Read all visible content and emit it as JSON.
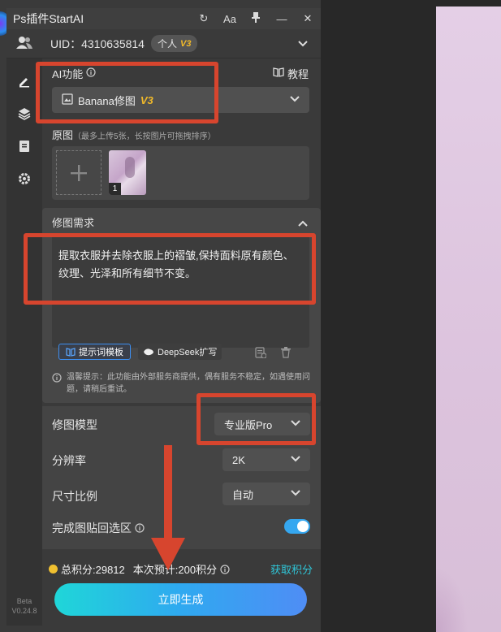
{
  "app": {
    "title": "Ps插件StartAI"
  },
  "titlebar": {
    "refresh": "↻",
    "font": "Aa",
    "pin": "⚲",
    "minimize": "—",
    "close": "✕"
  },
  "user": {
    "uid": "UID：4310635814",
    "plan": "个人",
    "version": "V3"
  },
  "sidebar": {
    "beta": "Beta",
    "version": "V0.24.8"
  },
  "ai_function": {
    "label": "AI功能",
    "tutorial": "教程",
    "selected": "Banana修图",
    "version": "V3"
  },
  "original": {
    "label": "原图",
    "hint": "（最多上传5张，长按图片可拖拽排序）",
    "thumb_index": "1"
  },
  "edit_request": {
    "label": "修图需求",
    "text": "提取衣服并去除衣服上的褶皱,保持面料原有颜色、纹理、光泽和所有细节不变。",
    "template_button": "提示词模板",
    "deepseek_button": "DeepSeek扩写",
    "notice": "温馨提示：此功能由外部服务商提供，偶有服务不稳定，如遇使用问题，请稍后重试。"
  },
  "settings": {
    "model_label": "修图模型",
    "model_value": "专业版Pro",
    "resolution_label": "分辨率",
    "resolution_value": "2K",
    "ratio_label": "尺寸比例",
    "ratio_value": "自动",
    "paste_label": "完成图贴回选区"
  },
  "footer": {
    "total_points": "总积分:29812",
    "estimate": "本次预计:200积分",
    "get_points": "获取积分",
    "generate": "立即生成"
  }
}
